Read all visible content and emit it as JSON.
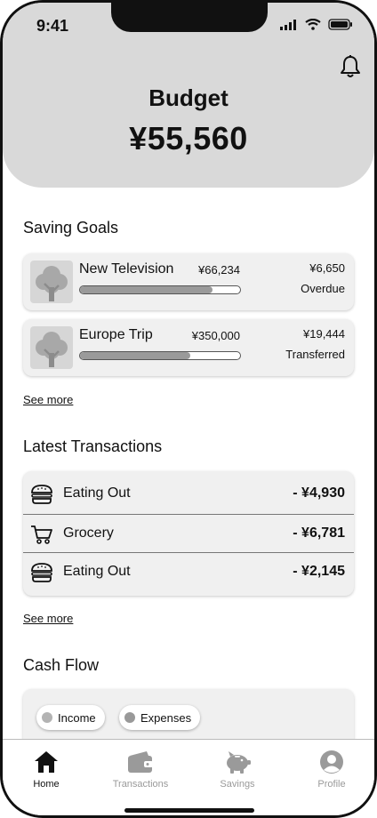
{
  "status_bar": {
    "time": "9:41"
  },
  "header": {
    "title": "Budget",
    "amount": "¥55,560"
  },
  "saving_goals": {
    "title": "Saving Goals",
    "items": [
      {
        "name": "New Television",
        "target": "¥66,234",
        "saved": "¥6,650",
        "status": "Overdue",
        "progress": 0.83
      },
      {
        "name": "Europe Trip",
        "target": "¥350,000",
        "saved": "¥19,444",
        "status": "Transferred",
        "progress": 0.69
      }
    ],
    "see_more": "See more"
  },
  "transactions": {
    "title": "Latest Transactions",
    "items": [
      {
        "icon": "burger-icon",
        "label": "Eating Out",
        "amount": "- ¥4,930"
      },
      {
        "icon": "cart-icon",
        "label": "Grocery",
        "amount": "- ¥6,781"
      },
      {
        "icon": "burger-icon",
        "label": "Eating Out",
        "amount": "- ¥2,145"
      }
    ],
    "see_more": "See more"
  },
  "cash_flow": {
    "title": "Cash Flow",
    "legend": [
      {
        "label": "Income",
        "color": "#b3b3b3"
      },
      {
        "label": "Expenses",
        "color": "#999999"
      }
    ]
  },
  "tab_bar": {
    "tabs": [
      {
        "label": "Home",
        "icon": "home-icon",
        "active": true
      },
      {
        "label": "Transactions",
        "icon": "wallet-icon",
        "active": false
      },
      {
        "label": "Savings",
        "icon": "piggy-bank-icon",
        "active": false
      },
      {
        "label": "Profile",
        "icon": "profile-icon",
        "active": false
      }
    ]
  },
  "colors": {
    "header_bg": "#d9d9d9",
    "active": "#111111",
    "inactive": "#9a9a9a"
  }
}
